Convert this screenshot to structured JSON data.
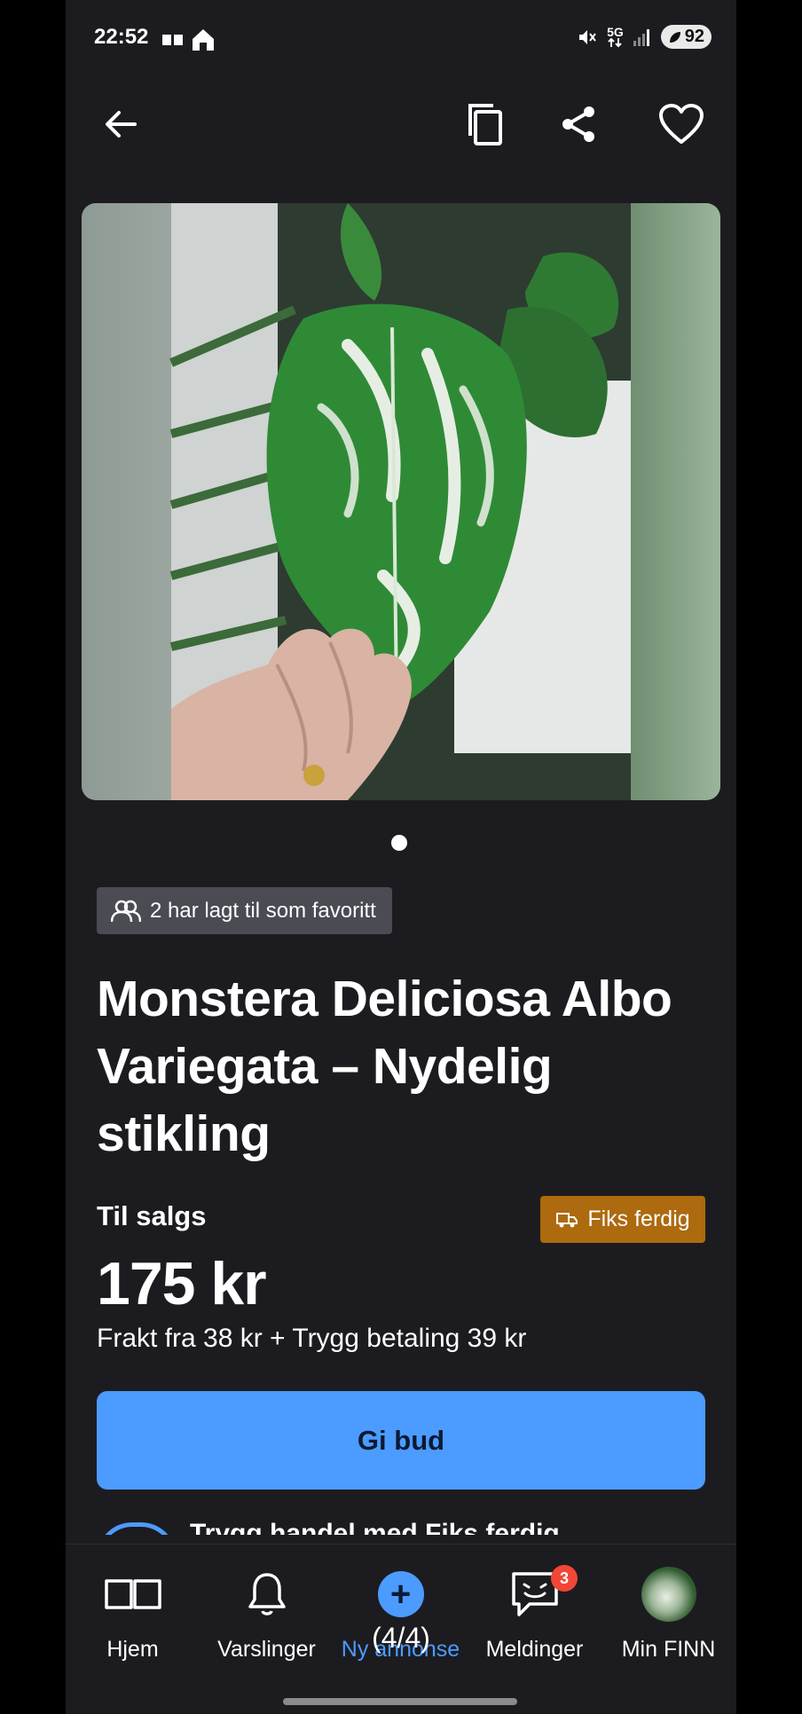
{
  "status_bar": {
    "time": "22:52",
    "network": "5G",
    "battery": "92"
  },
  "top_nav": {
    "icons": [
      "arrow-left-icon",
      "copy-icon",
      "share-icon",
      "heart-icon"
    ]
  },
  "gallery": {
    "image_count": 1,
    "current_index": 1
  },
  "listing": {
    "favorites_text": "2 har lagt til som favoritt",
    "title": "Monstera Deliciosa Albo Variegata – Nydelig stikling",
    "sale_label": "Til salgs",
    "fiks_ferdig_label": "Fiks ferdig",
    "price": "175 kr",
    "shipping_text": "Frakt fra 38 kr + Trygg betaling 39 kr",
    "bid_button_label": "Gi bud",
    "peek_text": "Trygg handel med Fiks ferdig"
  },
  "bottom_nav": {
    "tabs": [
      {
        "label": "Hjem",
        "icon": "book-open-icon",
        "active": false
      },
      {
        "label": "Varslinger",
        "icon": "bell-icon",
        "active": false
      },
      {
        "label": "Ny annonse",
        "icon": "plus-circle-icon",
        "active": true
      },
      {
        "label": "Meldinger",
        "icon": "chat-smile-icon",
        "active": false,
        "badge": "3"
      },
      {
        "label": "Min FINN",
        "icon": "avatar",
        "active": false
      }
    ],
    "page_indicator": "(4/4)"
  },
  "colors": {
    "background": "#1c1c20",
    "accent": "#4c9bff",
    "fiks_badge": "#ad6a0e",
    "favorite_badge": "#4a4b53",
    "notification": "#f24637"
  }
}
